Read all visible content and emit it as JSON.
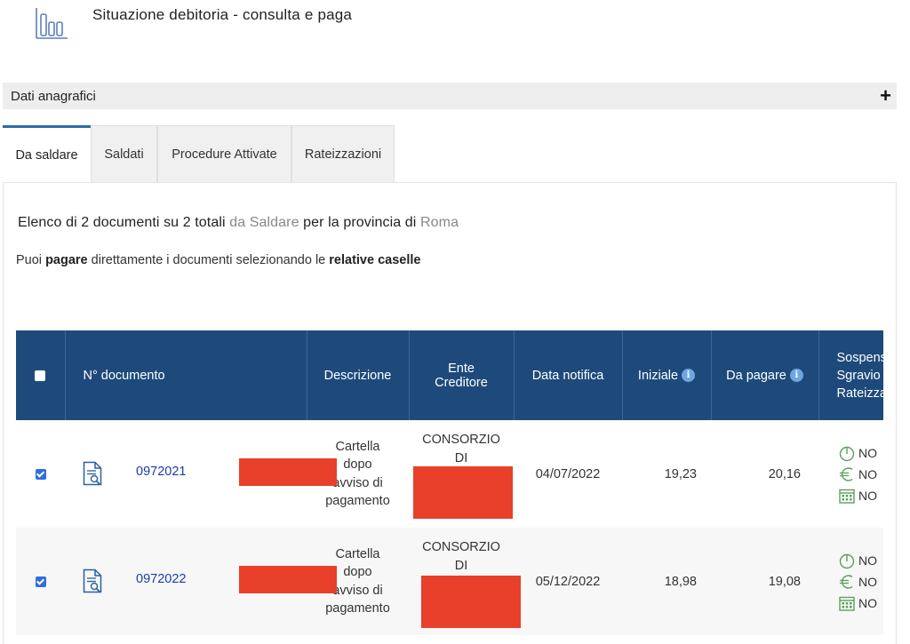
{
  "header": {
    "title": "Situazione debitoria - consulta e paga",
    "icon": "bar-chart-icon"
  },
  "panel": {
    "label": "Dati anagrafici",
    "toggle": "+"
  },
  "tabs": [
    {
      "label": "Da saldare",
      "active": true
    },
    {
      "label": "Saldati",
      "active": false
    },
    {
      "label": "Procedure Attivate",
      "active": false
    },
    {
      "label": "Rateizzazioni",
      "active": false
    }
  ],
  "summary": {
    "p1": "Elenco di 2 documenti su 2 totali ",
    "p2": "da Saldare",
    "p3": " per la provincia di ",
    "p4": "Roma"
  },
  "instructions": {
    "p1": "Puoi ",
    "p2": "pagare",
    "p3": " direttamente i documenti selezionando le ",
    "p4": "relative caselle"
  },
  "table": {
    "headers": {
      "doc": "N° documento",
      "desc": "Descrizione",
      "ente_l1": "Ente",
      "ente_l2": "Creditore",
      "data": "Data notifica",
      "iniziale": "Iniziale",
      "dapagare": "Da pagare",
      "flags_l1": "Sospens",
      "flags_l2": "Sgravio",
      "flags_l3": "Rateizza"
    },
    "rows": [
      {
        "checked": true,
        "doc_prefix": "0972021",
        "desc_lines": [
          "Cartella",
          "dopo",
          "avviso di",
          "pagamento"
        ],
        "ente_lines": [
          "CONSORZIO",
          "DI"
        ],
        "data": "04/07/2022",
        "iniziale": "19,23",
        "dapagare": "20,16",
        "flags": [
          "NO",
          "NO",
          "NO"
        ]
      },
      {
        "checked": true,
        "doc_prefix": "0972022",
        "desc_lines": [
          "Cartella",
          "dopo",
          "avviso di",
          "pagamento"
        ],
        "ente_lines": [
          "CONSORZIO",
          "DI"
        ],
        "data": "05/12/2022",
        "iniziale": "18,98",
        "dapagare": "19,08",
        "flags": [
          "NO",
          "NO",
          "NO"
        ]
      }
    ]
  },
  "colors": {
    "table_header": "#1e4a7b",
    "tab_accent": "#2d6ca8",
    "link": "#1a3cb0",
    "redaction": "#e8402a",
    "flag_icon": "#5aa05a"
  }
}
